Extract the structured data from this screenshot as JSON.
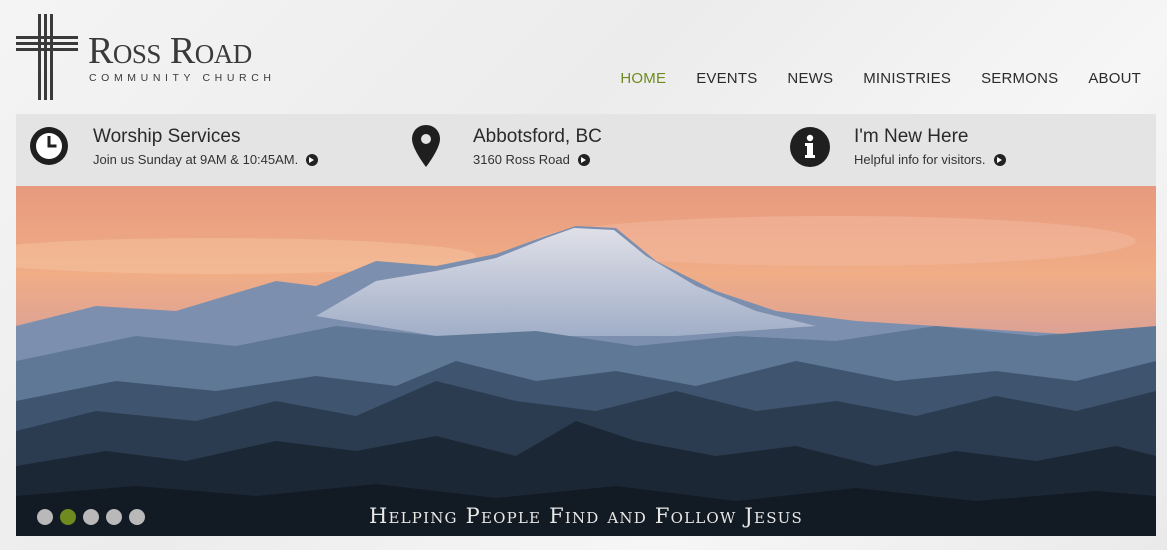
{
  "logo": {
    "title": "Ross Road",
    "subtitle": "COMMUNITY CHURCH"
  },
  "nav": {
    "items": [
      {
        "label": "HOME",
        "active": true
      },
      {
        "label": "EVENTS",
        "active": false
      },
      {
        "label": "NEWS",
        "active": false
      },
      {
        "label": "MINISTRIES",
        "active": false
      },
      {
        "label": "SERMONS",
        "active": false
      },
      {
        "label": "ABOUT",
        "active": false
      }
    ]
  },
  "info": [
    {
      "icon": "clock-icon",
      "title": "Worship Services",
      "sub": "Join us Sunday at 9AM & 10:45AM."
    },
    {
      "icon": "map-pin-icon",
      "title": "Abbotsford, BC",
      "sub": "3160 Ross Road"
    },
    {
      "icon": "info-icon",
      "title": "I'm New Here",
      "sub": "Helpful info for visitors."
    }
  ],
  "hero": {
    "tagline": "Helping People Find and Follow Jesus",
    "slide_count": 5,
    "active_slide": 2
  },
  "colors": {
    "accent": "#6f8a1e",
    "infobar": "#e4e4e4",
    "text": "#2b2b2b"
  }
}
